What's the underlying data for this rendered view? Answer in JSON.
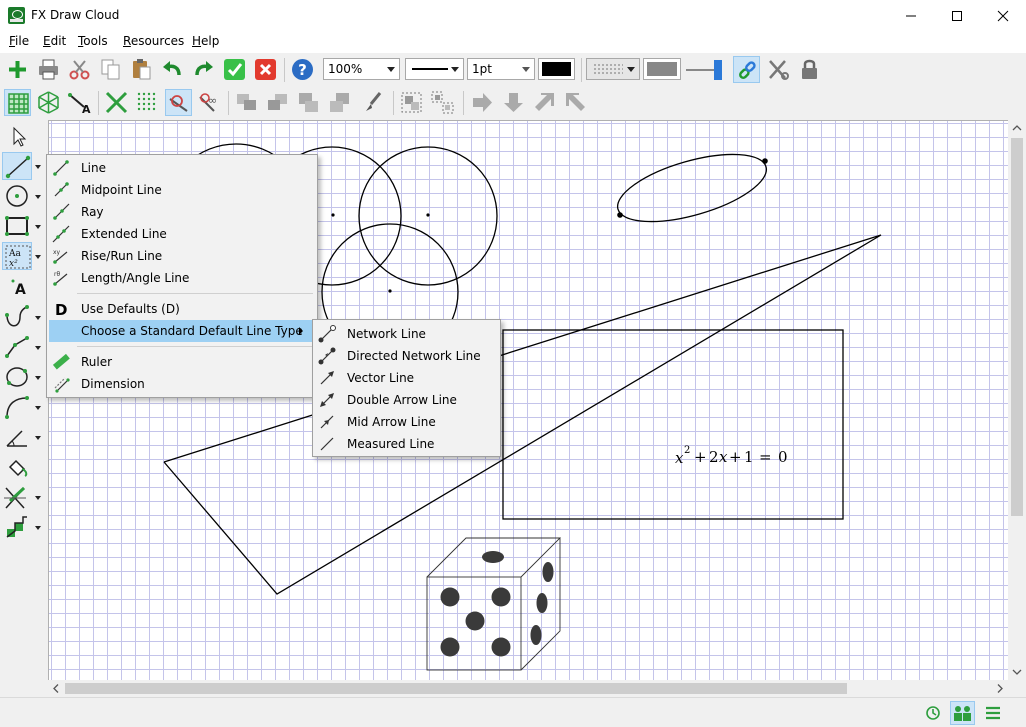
{
  "window": {
    "title": "FX Draw Cloud"
  },
  "menubar": [
    {
      "label": "File",
      "accel": "F",
      "rest": "ile"
    },
    {
      "label": "Edit",
      "accel": "E",
      "rest": "dit"
    },
    {
      "label": "Tools",
      "accel": "T",
      "rest": "ools"
    },
    {
      "label": "Resources",
      "accel": "R",
      "rest": "esources"
    },
    {
      "label": "Help",
      "accel": "H",
      "rest": "elp"
    }
  ],
  "toolbar": {
    "zoom": "100%",
    "line_width": "1pt",
    "line_color": "#000000",
    "fill_color": "#888888"
  },
  "line_menu": {
    "items": [
      {
        "label": "Line"
      },
      {
        "label": "Midpoint Line"
      },
      {
        "label": "Ray"
      },
      {
        "label": "Extended Line"
      },
      {
        "label": "Rise/Run Line"
      },
      {
        "label": "Length/Angle Line"
      },
      {
        "label": "Use Defaults (D)"
      },
      {
        "label": "Choose a Standard Default Line Type"
      },
      {
        "label": "Ruler"
      },
      {
        "label": "Dimension"
      }
    ]
  },
  "sub_menu": {
    "items": [
      {
        "label": "Network Line"
      },
      {
        "label": "Directed Network Line"
      },
      {
        "label": "Vector Line"
      },
      {
        "label": "Double Arrow Line"
      },
      {
        "label": "Mid Arrow Line"
      },
      {
        "label": "Measured Line"
      }
    ]
  },
  "drawing": {
    "equation": {
      "x": "x",
      "exp": "2",
      "rest_coef": "2",
      "rest_var": "x",
      "plus1": "+",
      "plus2": "+",
      "one": "1",
      "eq": "=",
      "zero": "0"
    }
  },
  "colors": {
    "accent": "#cce4f7",
    "highlight": "#9dd0f3",
    "grid": "#c4c4ea",
    "icon_green": "#2e9e3e"
  }
}
